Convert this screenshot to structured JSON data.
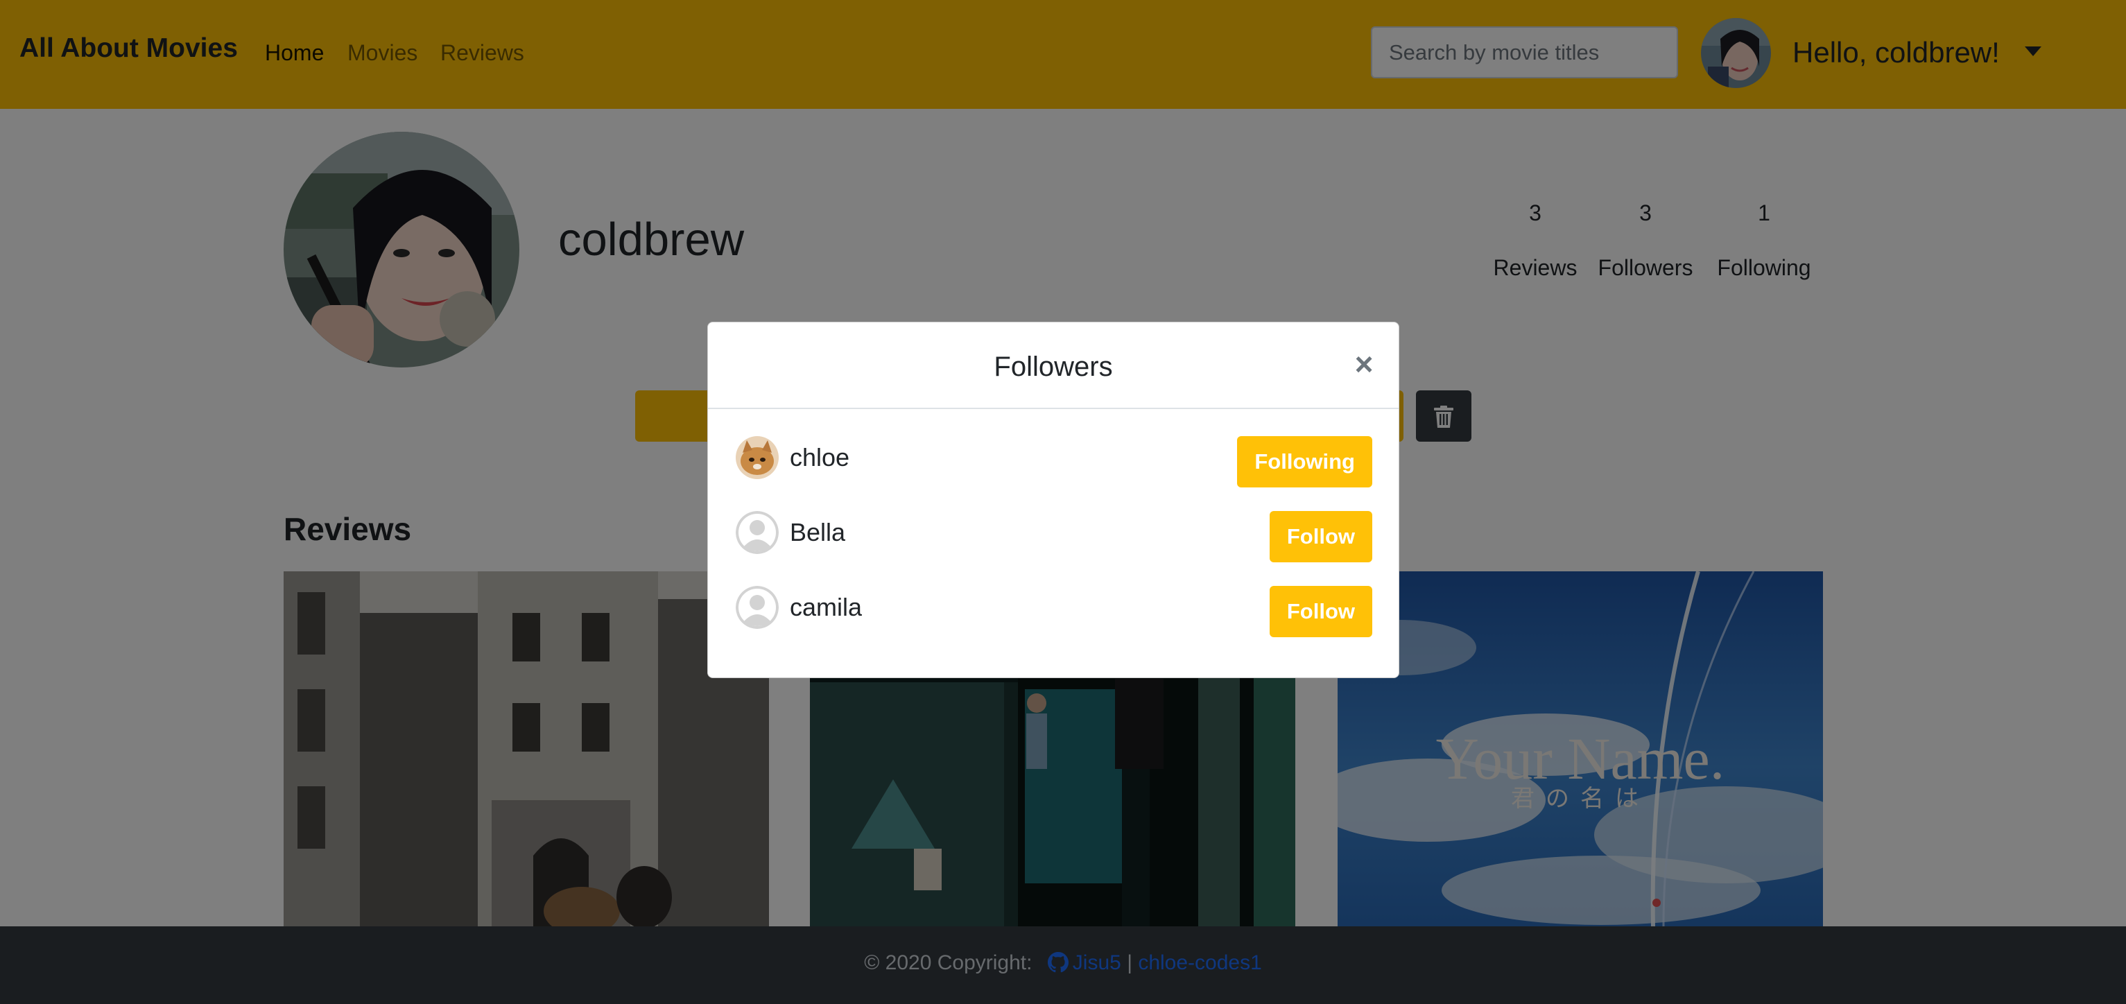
{
  "navbar": {
    "brand": "All About Movies",
    "links": [
      "Home",
      "Movies",
      "Reviews"
    ],
    "search_placeholder": "Search by movie titles",
    "greeting": "Hello, coldbrew!"
  },
  "profile": {
    "username": "coldbrew",
    "stats": [
      {
        "value": "3",
        "label": "Reviews"
      },
      {
        "value": "3",
        "label": "Followers"
      },
      {
        "value": "1",
        "label": "Following"
      }
    ]
  },
  "reviews_section": {
    "title": "Reviews",
    "posters": [
      {
        "name": "poster-black-and-white-street"
      },
      {
        "name": "poster-parasite"
      },
      {
        "name": "poster-your-name",
        "title": "Your Name.",
        "subtitle": "君の名は"
      }
    ]
  },
  "modal": {
    "title": "Followers",
    "close_symbol": "×",
    "followers": [
      {
        "name": "chloe",
        "button": "Following",
        "avatar": "cat-photo"
      },
      {
        "name": "Bella",
        "button": "Follow",
        "avatar": "default-user-icon"
      },
      {
        "name": "camila",
        "button": "Follow",
        "avatar": "default-user-icon"
      }
    ]
  },
  "footer": {
    "copyright": "© 2020 Copyright:",
    "github_user": "Jisu5",
    "separator": "|",
    "second_user": "chloe-codes1"
  },
  "colors": {
    "accent": "#ffc107",
    "dark": "#343a40",
    "link": "#1e6fff"
  }
}
